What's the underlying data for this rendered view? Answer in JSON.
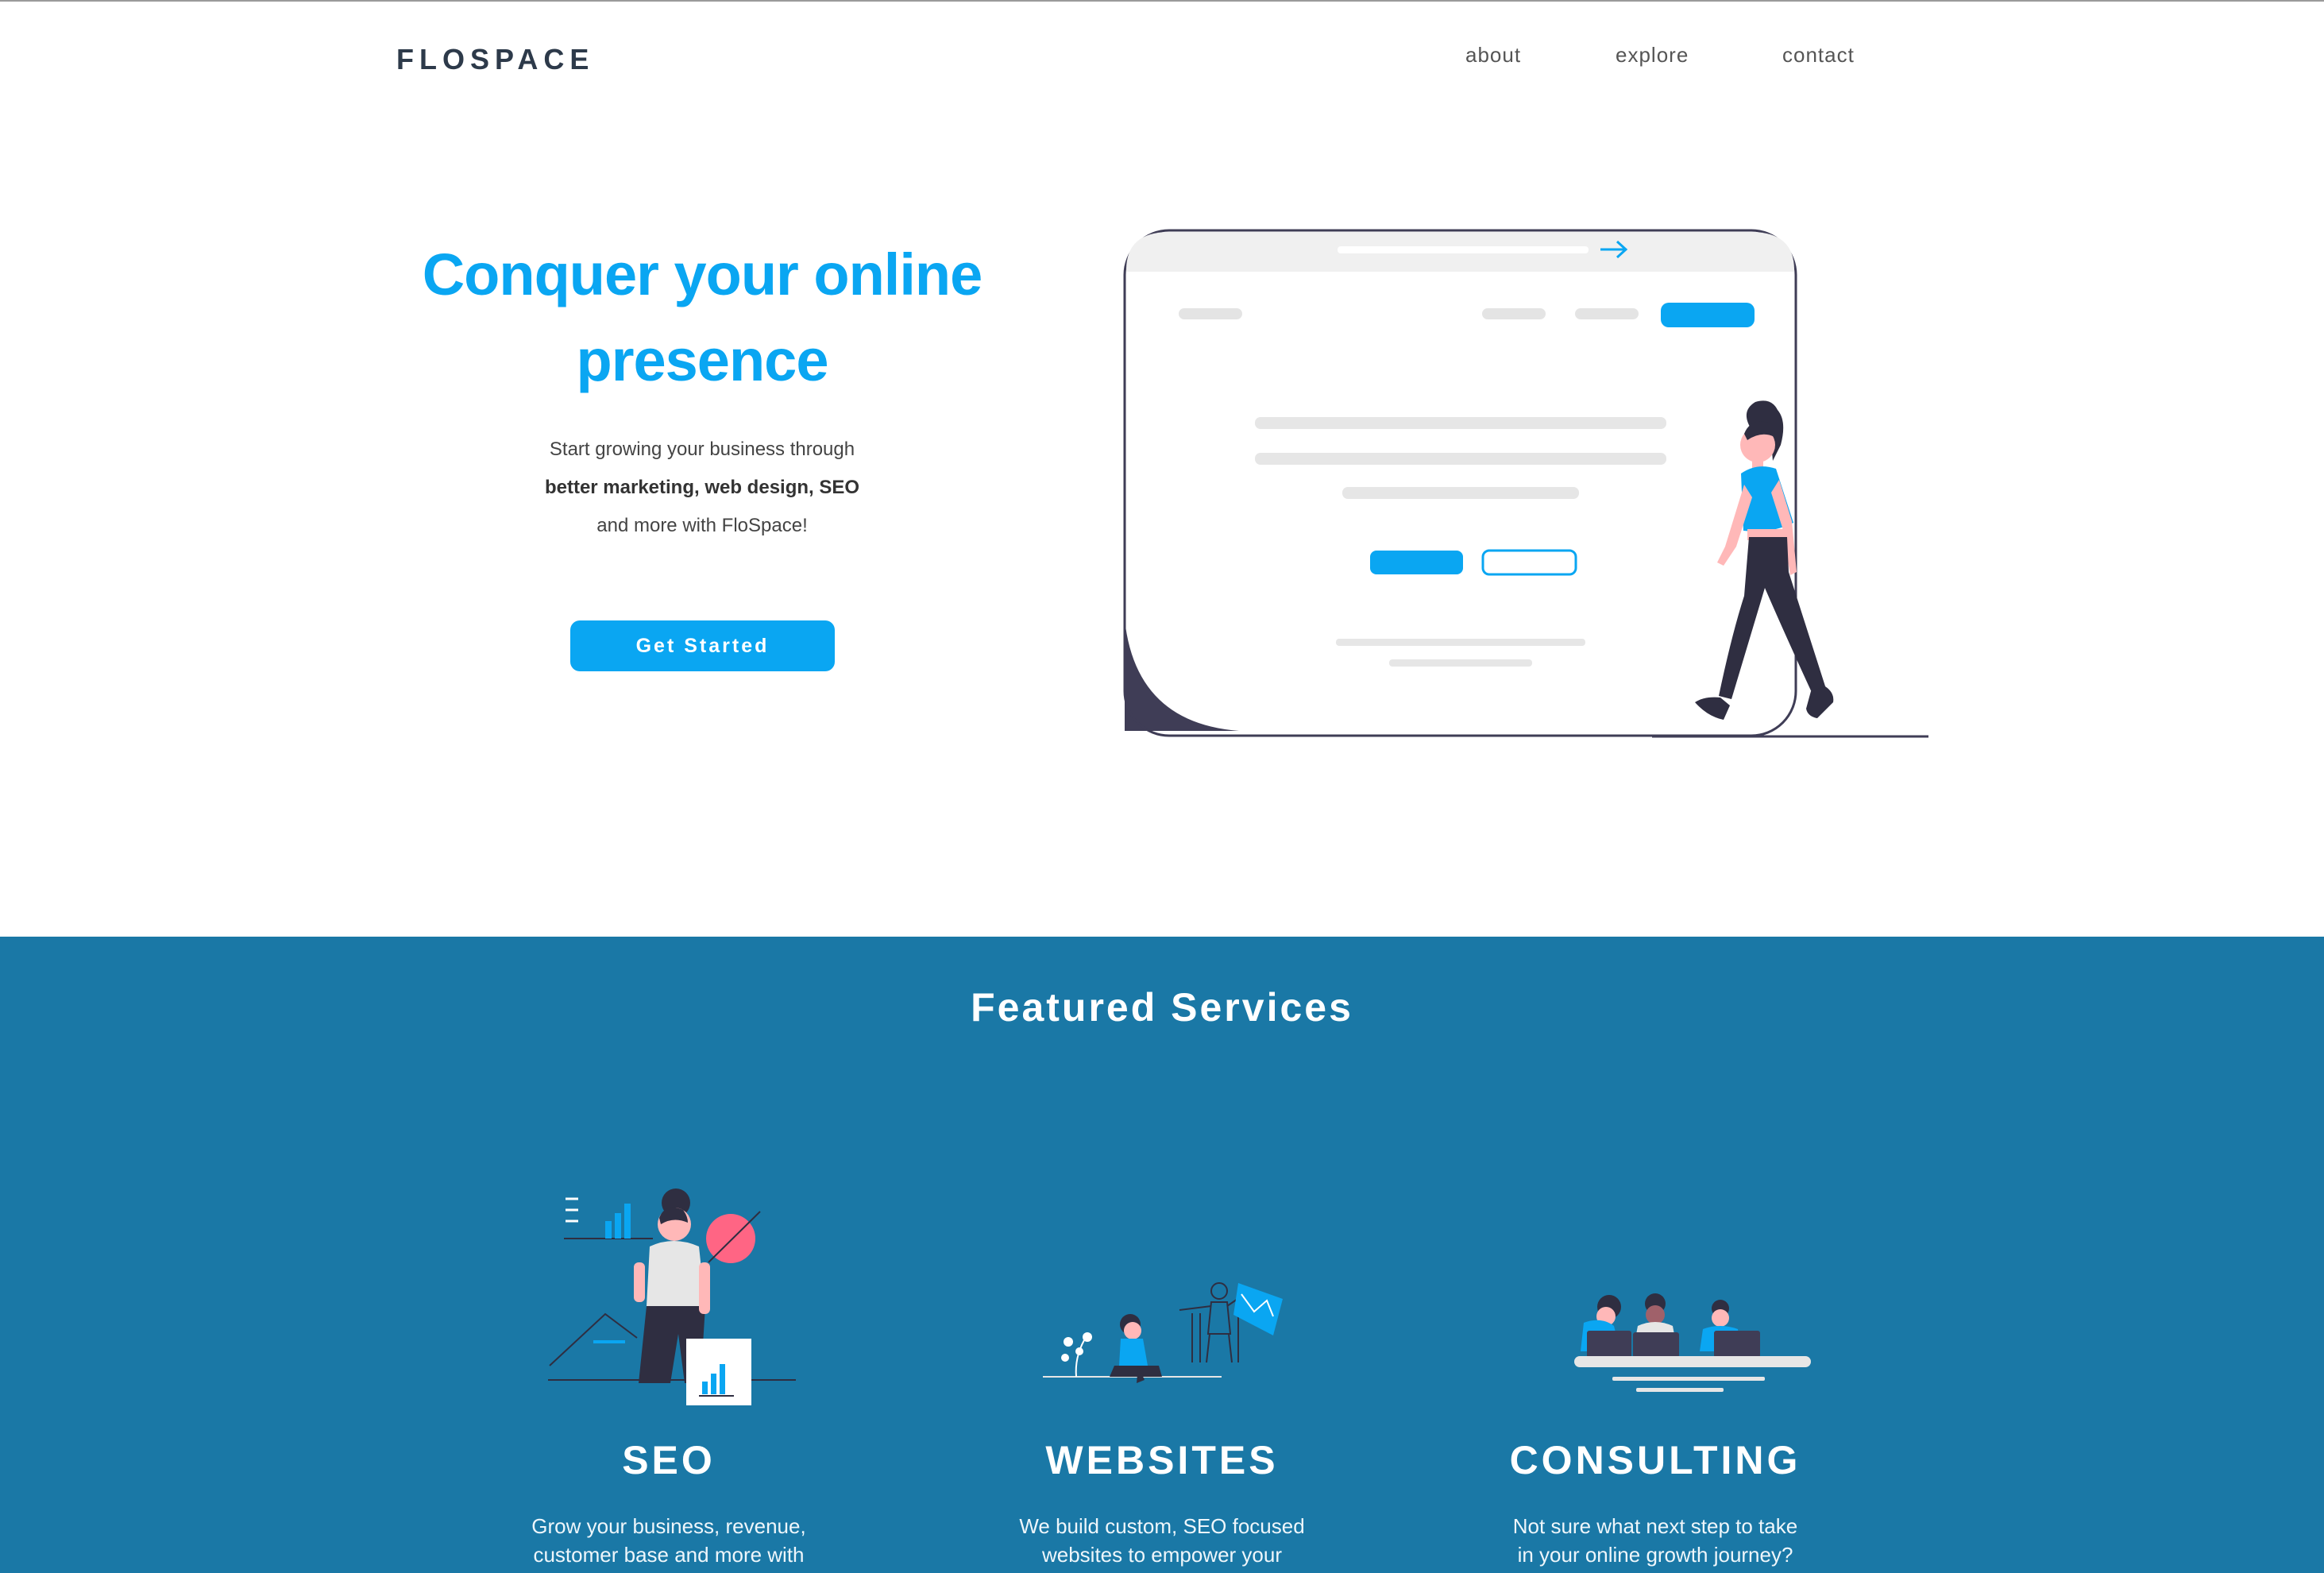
{
  "header": {
    "logo": "FLOSPACE",
    "nav": [
      {
        "label": "about"
      },
      {
        "label": "explore"
      },
      {
        "label": "contact"
      }
    ]
  },
  "hero": {
    "title_line1": "Conquer your online",
    "title_line2": "presence",
    "sub_line1": "Start growing your business through",
    "sub_line2": "better marketing, web design, SEO",
    "sub_line3": "and more with FloSpace!",
    "cta_label": "Get Started"
  },
  "services": {
    "title": "Featured Services",
    "items": [
      {
        "title": "SEO",
        "desc_line1": "Grow your business, revenue,",
        "desc_line2": "customer base and more with"
      },
      {
        "title": "WEBSITES",
        "desc_line1": "We build custom, SEO focused",
        "desc_line2": "websites to empower your"
      },
      {
        "title": "CONSULTING",
        "desc_line1": "Not sure what next step to take",
        "desc_line2": "in your online growth journey?"
      }
    ]
  },
  "colors": {
    "accent": "#0aa6f2",
    "services_bg": "#1a78a6",
    "logo": "#2d3a4a"
  }
}
